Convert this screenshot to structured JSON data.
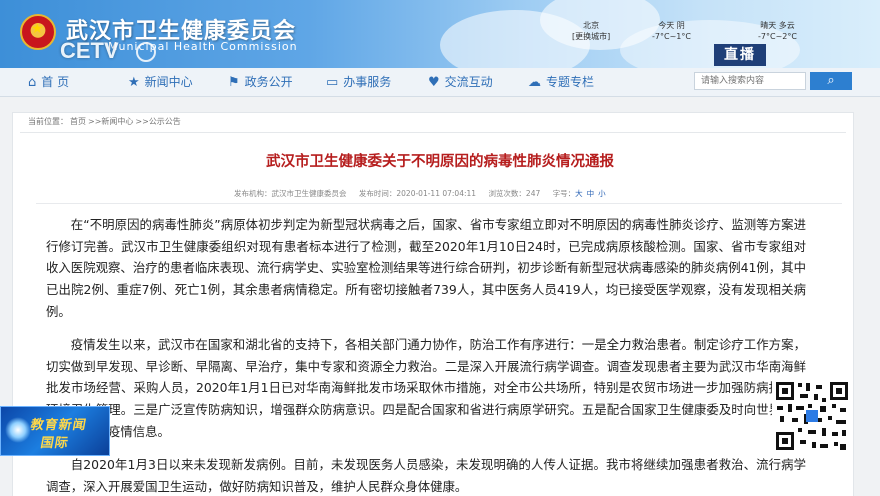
{
  "header": {
    "site_title": "武汉市卫生健康委员会",
    "site_subtitle": "Municipal Health Commission",
    "channel_logo": "CETV",
    "weather": {
      "city": "北京",
      "city_sub": "[更换城市]",
      "today_label": "今天 阴",
      "today_temp": "-7°C~1°C",
      "tomorrow_label": "晴天 多云",
      "tomorrow_temp": "-7°C~2°C"
    },
    "live_label": "直播"
  },
  "nav": {
    "items": [
      {
        "label": "首 页",
        "icon": "home-icon"
      },
      {
        "label": "新闻中心",
        "icon": "star-icon"
      },
      {
        "label": "政务公开",
        "icon": "flag-icon"
      },
      {
        "label": "办事服务",
        "icon": "monitor-icon"
      },
      {
        "label": "交流互动",
        "icon": "heart-icon"
      },
      {
        "label": "专题专栏",
        "icon": "chat-icon"
      }
    ],
    "search_placeholder": "请输入搜索内容",
    "search_icon": "search-icon"
  },
  "breadcrumb": {
    "prefix": "当前位置：",
    "items": [
      "首页",
      ">>新闻中心",
      ">>公示公告"
    ]
  },
  "article": {
    "title": "武汉市卫生健康委关于不明原因的病毒性肺炎情况通报",
    "meta": {
      "source": "发布机构：武汉市卫生健康委员会",
      "time": "发布时间：2020-01-11 07:04:11",
      "views": "浏览次数：247",
      "font_label": "字号：",
      "font_sizes": [
        "大",
        "中",
        "小"
      ]
    },
    "paragraphs": [
      "在“不明原因的病毒性肺炎”病原体初步判定为新型冠状病毒之后，国家、省市专家组立即对不明原因的病毒性肺炎诊疗、监测等方案进行修订完善。武汉市卫生健康委组织对现有患者标本进行了检测，截至2020年1月10日24时，已完成病原核酸检测。国家、省市专家组对收入医院观察、治疗的患者临床表现、流行病学史、实验室检测结果等进行综合研判，初步诊断有新型冠状病毒感染的肺炎病例41例，其中已出院2例、重症7例、死亡1例，其余患者病情稳定。所有密切接触者739人，其中医务人员419人，均已接受医学观察，没有发现相关病例。",
      "疫情发生以来，武汉市在国家和湖北省的支持下，各相关部门通力协作，防治工作有序进行：一是全力救治患者。制定诊疗工作方案，切实做到早发现、早诊断、早隔离、早治疗，集中专家和资源全力救治。二是深入开展流行病学调查。调查发现患者主要为武汉市华南海鲜批发市场经营、采购人员，2020年1月1日已对华南海鲜批发市场采取休市措施，对全市公共场所，特别是农贸市场进一步加强防病指导和环境卫生管理。三是广泛宣传防病知识，增强群众防病意识。四是配合国家和省进行病原学研究。五是配合国家卫生健康委及时向世界卫生组织等通报疫情信息。",
      "自2020年1月3日以来未发现新发病例。目前，未发现医务人员感染，未发现明确的人传人证据。我市将继续加强患者救治、流行病学调查，深入开展爱国卫生运动，做好防病知识普及，维护人民群众身体健康。"
    ]
  },
  "overlay": {
    "news_badge_line1": "教育新闻",
    "news_badge_line2": "国际"
  },
  "colors": {
    "title_red": "#b61e1e",
    "nav_blue": "#2f6fb7",
    "live_bg": "#1f3f78"
  }
}
